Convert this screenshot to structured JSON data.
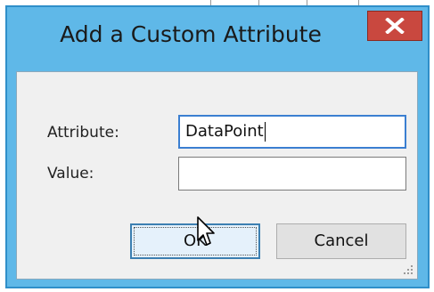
{
  "dialog": {
    "title": "Add a Custom Attribute",
    "close_icon": "close-x-icon"
  },
  "form": {
    "attribute_label": "Attribute:",
    "attribute_value": "DataPoint",
    "value_label": "Value:",
    "value_value": ""
  },
  "buttons": {
    "ok_label": "OK",
    "cancel_label": "Cancel"
  },
  "colors": {
    "title_bar": "#5fb8e8",
    "close_button": "#c9483f",
    "focus_border": "#3b7fd1"
  }
}
